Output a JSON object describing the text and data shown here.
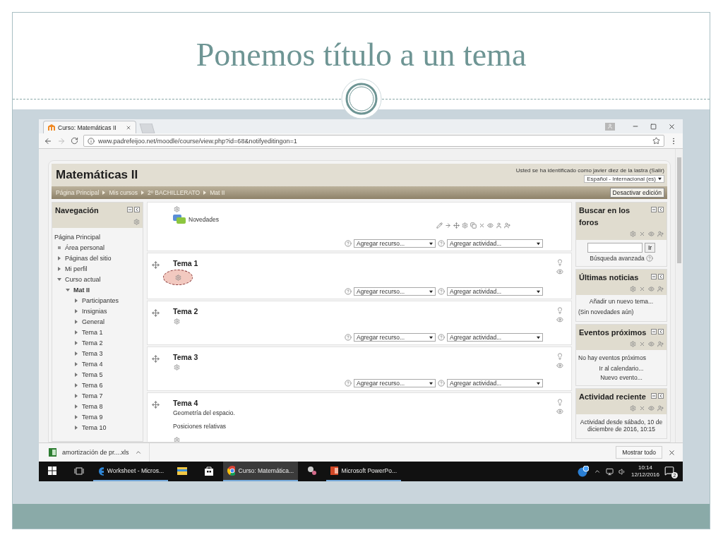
{
  "slide": {
    "title": "Ponemos título a un tema"
  },
  "browser": {
    "tabs": [
      {
        "label": "Curso: Matemáticas II",
        "selected": true
      }
    ],
    "url": "www.padrefeijoo.net/moodle/course/view.php?id=68&notifyeditingon=1"
  },
  "page": {
    "course_title": "Matemáticas II",
    "login_info": "Usted se ha identificado como javier diez de la lastra (Salir)",
    "language": "Español - Internacional (es)",
    "breadcrumb": [
      "Página Principal",
      "Mis cursos",
      "2º BACHILLERATO",
      "Mat II"
    ],
    "edit_button": "Desactivar edición"
  },
  "navigation": {
    "title": "Navegación",
    "items": [
      {
        "kind": "root",
        "label": "Página Principal"
      },
      {
        "kind": "leaf",
        "label": "Área personal"
      },
      {
        "kind": "branch",
        "label": "Páginas del sitio",
        "expanded": false
      },
      {
        "kind": "branch",
        "label": "Mi perfil",
        "expanded": false
      },
      {
        "kind": "branch",
        "label": "Curso actual",
        "expanded": true,
        "children": [
          {
            "kind": "course",
            "label": "Mat II",
            "expanded": true,
            "children": [
              {
                "kind": "branch",
                "label": "Participantes",
                "expanded": false
              },
              {
                "kind": "branch",
                "label": "Insignias",
                "expanded": false
              },
              {
                "kind": "branch",
                "label": "General",
                "expanded": false
              },
              {
                "kind": "branch",
                "label": "Tema 1",
                "expanded": false
              },
              {
                "kind": "branch",
                "label": "Tema 2",
                "expanded": false
              },
              {
                "kind": "branch",
                "label": "Tema 3",
                "expanded": false
              },
              {
                "kind": "branch",
                "label": "Tema 4",
                "expanded": false
              },
              {
                "kind": "branch",
                "label": "Tema 5",
                "expanded": false
              },
              {
                "kind": "branch",
                "label": "Tema 6",
                "expanded": false
              },
              {
                "kind": "branch",
                "label": "Tema 7",
                "expanded": false
              },
              {
                "kind": "branch",
                "label": "Tema 8",
                "expanded": false
              },
              {
                "kind": "branch",
                "label": "Tema 9",
                "expanded": false
              },
              {
                "kind": "branch",
                "label": "Tema 10",
                "expanded": false
              }
            ]
          }
        ]
      }
    ]
  },
  "sections": [
    {
      "kind": "general",
      "activities": [
        "Novedades"
      ],
      "add_resource": "Agregar recurso...",
      "add_activity": "Agregar actividad...",
      "highlighted": false
    },
    {
      "kind": "topic",
      "title": "Tema 1",
      "add_resource": "Agregar recurso...",
      "add_activity": "Agregar actividad...",
      "highlighted": true
    },
    {
      "kind": "topic",
      "title": "Tema 2",
      "add_resource": "Agregar recurso...",
      "add_activity": "Agregar actividad...",
      "highlighted": false
    },
    {
      "kind": "topic",
      "title": "Tema 3",
      "add_resource": "Agregar recurso...",
      "add_activity": "Agregar actividad...",
      "highlighted": false
    },
    {
      "kind": "topic",
      "title": "Tema 4",
      "summary": [
        "Geometría del espacio.",
        "Posiciones relativas"
      ],
      "highlighted": false
    }
  ],
  "blocks": [
    {
      "kind": "search",
      "title": "Buscar en los foros",
      "button": "Ir",
      "link": "Búsqueda avanzada"
    },
    {
      "kind": "list",
      "title": "Últimas noticias",
      "lines": [
        {
          "kind": "link",
          "text": "Añadir un nuevo tema..."
        },
        {
          "kind": "text",
          "text": "(Sin novedades aún)"
        }
      ]
    },
    {
      "kind": "list",
      "title": "Eventos próximos",
      "lines": [
        {
          "kind": "text",
          "text": "No hay eventos próximos"
        },
        {
          "kind": "link",
          "text": "Ir al calendario..."
        },
        {
          "kind": "link",
          "text": "Nuevo evento..."
        }
      ]
    },
    {
      "kind": "list",
      "title": "Actividad reciente",
      "lines": [
        {
          "kind": "centered",
          "text": "Actividad desde sábado, 10 de diciembre de 2016, 10:15"
        }
      ]
    }
  ],
  "downloads": {
    "file": "amortización de pr....xls",
    "show_all": "Mostrar todo"
  },
  "taskbar": {
    "items": [
      {
        "kind": "start",
        "selected": false
      },
      {
        "kind": "taskview",
        "selected": false
      },
      {
        "kind": "edge",
        "label": "Worksheet - Micros...",
        "selected": false
      },
      {
        "kind": "explorer",
        "selected": false
      },
      {
        "kind": "store",
        "selected": false
      },
      {
        "kind": "chrome",
        "label": "Curso: Matemática...",
        "selected": true
      },
      {
        "kind": "snip",
        "selected": false
      },
      {
        "kind": "powerpoint",
        "label": "Microsoft PowerPo...",
        "selected": false
      }
    ],
    "time": "10:14",
    "date": "12/12/2016",
    "notifications": "2"
  }
}
